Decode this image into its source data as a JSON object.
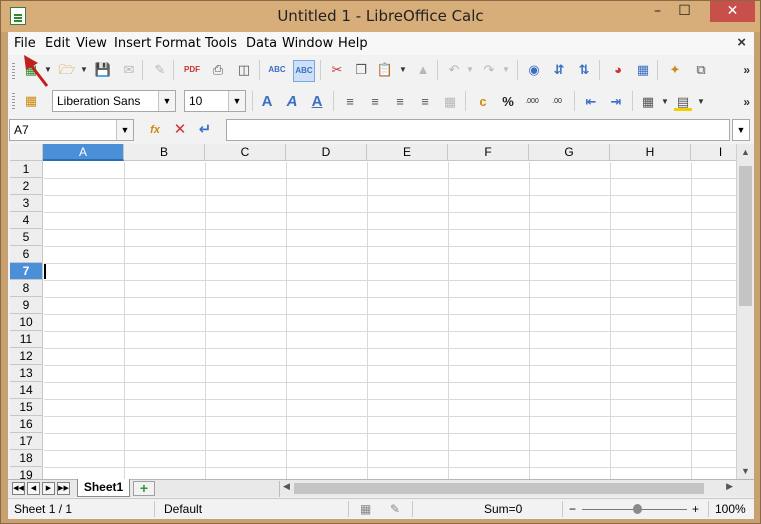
{
  "window": {
    "title": "Untitled 1 - LibreOffice Calc",
    "minimize": "–",
    "maximize": "☐",
    "close": "✕"
  },
  "menubar": {
    "items": [
      "File",
      "Edit",
      "View",
      "Insert",
      "Format",
      "Tools",
      "Data",
      "Window",
      "Help"
    ],
    "close_doc": "×"
  },
  "toolbar1": {
    "icons": [
      "new-spreadsheet-icon",
      "open-icon",
      "save-icon",
      "email-icon",
      "edit-file-icon",
      "export-pdf-icon",
      "print-icon",
      "print-preview-icon",
      "spellcheck-icon",
      "autospellcheck-icon",
      "cut-icon",
      "copy-icon",
      "paste-icon",
      "clone-formatting-icon",
      "undo-icon",
      "redo-icon",
      "navigator-icon",
      "sort-ascending-icon",
      "sort-descending-icon",
      "chart-icon",
      "pivot-table-icon",
      "gallery-icon",
      "show-draw-functions-icon"
    ],
    "more": "»"
  },
  "toolbar2": {
    "font_name": "Liberation Sans",
    "font_size": "10",
    "icons": [
      "bold-icon",
      "italic-icon",
      "underline-icon",
      "align-left-icon",
      "align-center-icon",
      "align-right-icon",
      "justify-icon",
      "merge-cells-icon",
      "currency-icon",
      "percent-icon",
      "add-decimal-icon",
      "delete-decimal-icon",
      "decrease-indent-icon",
      "increase-indent-icon",
      "borders-icon",
      "background-color-icon"
    ],
    "more": "»"
  },
  "formula_bar": {
    "name_box": "A7",
    "input_value": ""
  },
  "grid": {
    "columns": [
      "A",
      "B",
      "C",
      "D",
      "E",
      "F",
      "G",
      "H",
      "I"
    ],
    "rows": [
      "1",
      "2",
      "3",
      "4",
      "5",
      "6",
      "7",
      "8",
      "9",
      "10",
      "11",
      "12",
      "13",
      "14",
      "15",
      "16",
      "17",
      "18",
      "19"
    ],
    "selected_column": "A",
    "selected_row": "7"
  },
  "sheets": {
    "tabs": [
      "Sheet1"
    ],
    "active": "Sheet1",
    "add_label": "+"
  },
  "statusbar": {
    "sheet_position": "Sheet 1 / 1",
    "page_style": "Default",
    "sum": "Sum=0",
    "zoom": "100%",
    "zoom_minus": "−",
    "zoom_plus": "+"
  },
  "colors": {
    "title_bar": "#d7ad7a",
    "selection": "#4a90d9",
    "close_button": "#c7504a",
    "annotation_arrow": "#c0201e"
  }
}
